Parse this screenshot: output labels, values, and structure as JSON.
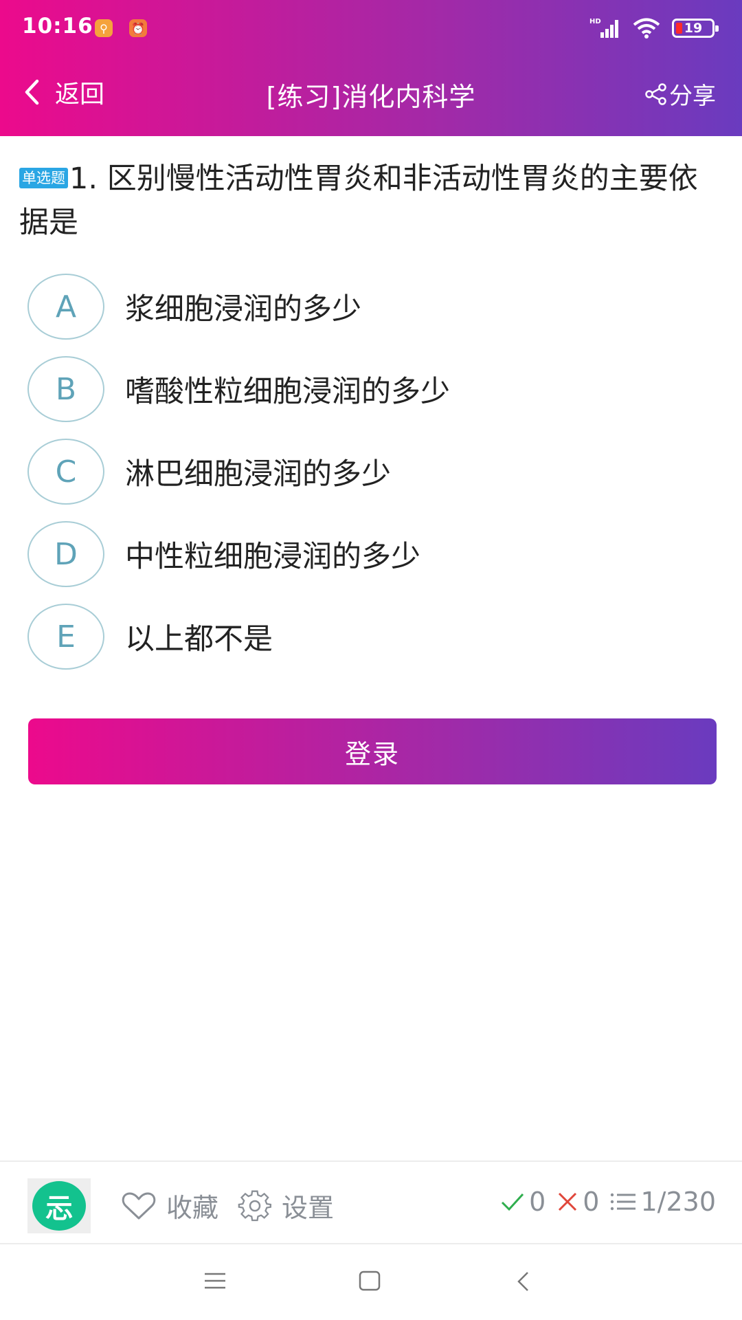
{
  "status_bar": {
    "time": "10:16",
    "network_label": "HD",
    "battery": "19"
  },
  "header": {
    "back_label": "返回",
    "title": "[练习]消化内科学",
    "share_label": "分享"
  },
  "question": {
    "type_badge": "单选题",
    "text": "1. 区别慢性活动性胃炎和非活动性胃炎的主要依据是",
    "options": [
      {
        "letter": "A",
        "text": "浆细胞浸润的多少"
      },
      {
        "letter": "B",
        "text": "嗜酸性粒细胞浸润的多少"
      },
      {
        "letter": "C",
        "text": "淋巴细胞浸润的多少"
      },
      {
        "letter": "D",
        "text": "中性粒细胞浸润的多少"
      },
      {
        "letter": "E",
        "text": "以上都不是"
      }
    ]
  },
  "login_button": "登录",
  "bottom_bar": {
    "logo_char": "忈",
    "favorite_label": "收藏",
    "settings_label": "设置",
    "correct_count": "0",
    "wrong_count": "0",
    "progress": "1/230"
  },
  "colors": {
    "gradient_start": "#ec0a8c",
    "gradient_end": "#6a3bbf",
    "badge_blue": "#2aa6e4",
    "option_letter": "#5fa3b8",
    "logo_green": "#13c28e",
    "correct_green": "#2fae4e",
    "wrong_red": "#e0463a"
  },
  "icons": [
    "back-chevron-icon",
    "share-icon",
    "heart-icon",
    "gear-icon",
    "check-icon",
    "cross-icon",
    "list-icon",
    "menu-icon",
    "home-square-icon",
    "back-triangle-icon"
  ]
}
